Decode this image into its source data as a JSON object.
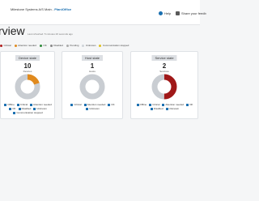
{
  "topbar": {
    "breadcrumb_prefix": "Milestone Systems A/S Main -",
    "breadcrumb_app": "PlaniOffice",
    "help_label": "Help",
    "share_label": "Share your feedb"
  },
  "page": {
    "title": "rview",
    "subtitle": "Last refreshed: 5 minutes 26 seconds ago"
  },
  "status_legend": [
    {
      "label": "Critical",
      "color": "#b01f1f"
    },
    {
      "label": "Attention needed",
      "color": "#e08a1e"
    },
    {
      "label": "OK",
      "color": "#2e8b3a"
    },
    {
      "label": "Disabled",
      "color": "#888888"
    },
    {
      "label": "Pending",
      "color": "#aaaaaa"
    },
    {
      "label": "Unknown",
      "color": "#cfd3d8"
    },
    {
      "label": "Communication stopped",
      "color": "#e0c21e"
    }
  ],
  "panels": [
    {
      "title": "Device state",
      "count": "10",
      "count_label": "Devices",
      "legend": [
        "Offline",
        "Critical",
        "Attention needed",
        "OK",
        "Disabled",
        "Unknown",
        "Communication stopped"
      ],
      "segments": [
        {
          "value": 0.2,
          "color": "#e08a1e"
        },
        {
          "value": 0.8,
          "color": "#c9cdd2"
        }
      ]
    },
    {
      "title": "Host state",
      "count": "1",
      "count_label": "Hosts",
      "legend": [
        "Critical",
        "Attention needed",
        "OK",
        "Unknown"
      ],
      "segments": [
        {
          "value": 1.0,
          "color": "#c9cdd2"
        }
      ]
    },
    {
      "title": "Service state",
      "count": "2",
      "count_label": "Services",
      "legend": [
        "Offline",
        "Critical",
        "Attention needed",
        "OK",
        "Disabled",
        "Unknown"
      ],
      "segments": [
        {
          "value": 0.5,
          "color": "#a01818"
        },
        {
          "value": 0.5,
          "color": "#c9cdd2"
        }
      ]
    }
  ]
}
